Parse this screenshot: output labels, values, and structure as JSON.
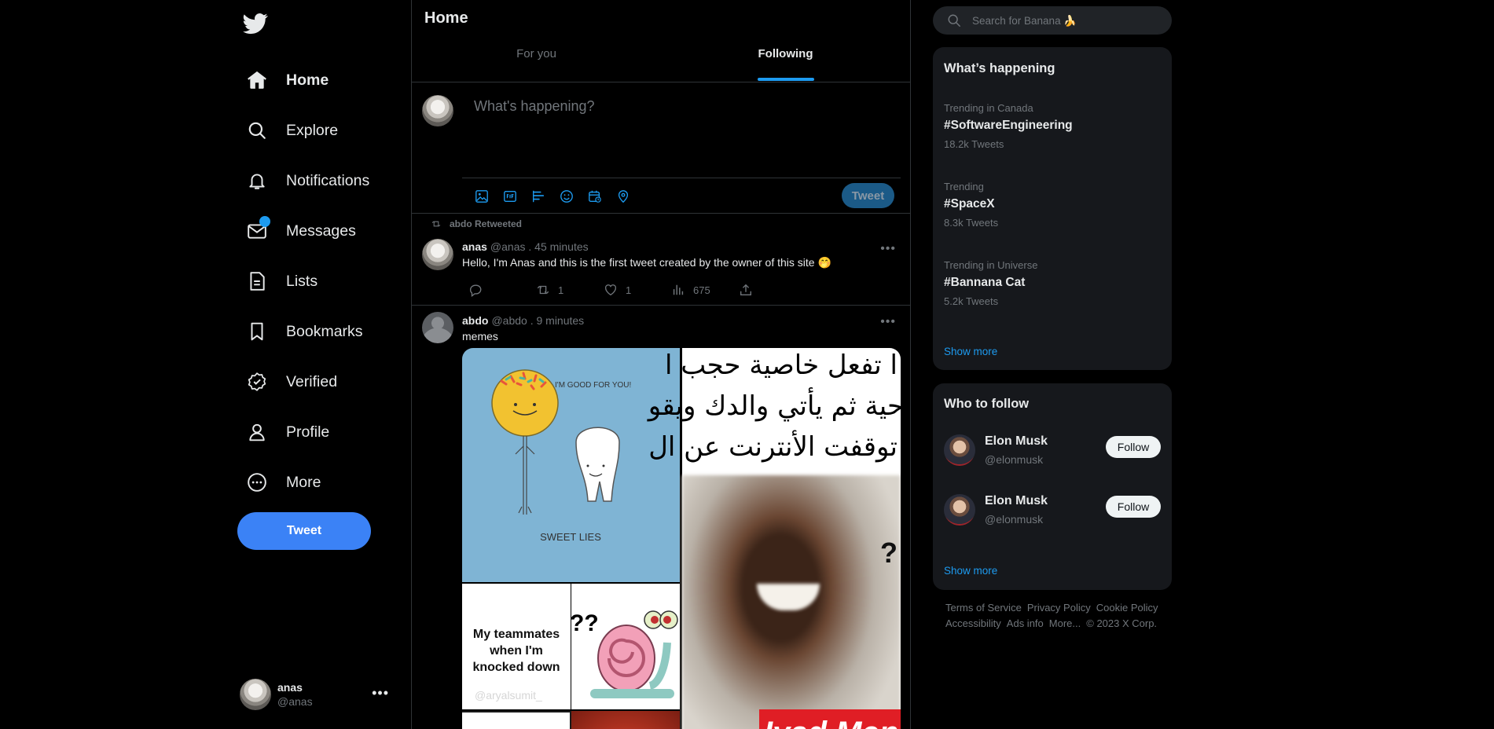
{
  "sidebar": {
    "nav": [
      {
        "label": "Home",
        "icon": "home-icon"
      },
      {
        "label": "Explore",
        "icon": "search-icon"
      },
      {
        "label": "Notifications",
        "icon": "bell-icon"
      },
      {
        "label": "Messages",
        "icon": "envelope-icon"
      },
      {
        "label": "Lists",
        "icon": "list-icon"
      },
      {
        "label": "Bookmarks",
        "icon": "bookmark-icon"
      },
      {
        "label": "Verified",
        "icon": "verified-icon"
      },
      {
        "label": "Profile",
        "icon": "person-icon"
      },
      {
        "label": "More",
        "icon": "more-circle-icon"
      }
    ],
    "tweet_button": "Tweet",
    "account": {
      "name": "anas",
      "handle": "@anas"
    }
  },
  "main": {
    "title": "Home",
    "tabs": [
      {
        "label": "For you"
      },
      {
        "label": "Following"
      }
    ],
    "composer": {
      "placeholder": "What's happening?",
      "tweet_button": "Tweet"
    },
    "tweets": [
      {
        "retweeted_by": "abdo Retweeted",
        "name": "anas",
        "meta": "@anas . 45 minutes",
        "text": "Hello, I'm Anas and this is the first tweet created by the owner of this site 🤭",
        "replies": "",
        "retweets": "1",
        "likes": "1",
        "views": "675"
      },
      {
        "name": "abdo",
        "meta": "@abdo . 9 minutes",
        "text": "memes",
        "media": {
          "m1_caption": "SWEET LIES",
          "m1_bubble": "I'M GOOD FOR YOU!",
          "m2_arabic_1": "ا تفعل خاصية حجب ا",
          "m2_arabic_2": "حية ثم يأتي والدك ويقو",
          "m2_arabic_3": "توقفت الأنترنت عن ال",
          "m2_brand": "Iyad Men",
          "m3_text": "My teammates when I'm knocked down",
          "m3_watermark": "@aryalsumit_",
          "m4_marks": "??"
        }
      }
    ]
  },
  "right": {
    "search_placeholder": "Search for Banana 🍌",
    "happening": {
      "title": "What’s happening",
      "trends": [
        {
          "context": "Trending in Canada",
          "tag": "#SoftwareEngineering",
          "count": "18.2k Tweets"
        },
        {
          "context": "Trending",
          "tag": "#SpaceX",
          "count": "8.3k Tweets"
        },
        {
          "context": "Trending in Universe",
          "tag": "#Bannana Cat",
          "count": "5.2k Tweets"
        }
      ],
      "show_more": "Show more"
    },
    "who_to_follow": {
      "title": "Who to follow",
      "people": [
        {
          "name": "Elon Musk",
          "handle": "@elonmusk",
          "button": "Follow"
        },
        {
          "name": "Elon Musk",
          "handle": "@elonmusk",
          "button": "Follow"
        }
      ],
      "show_more": "Show more"
    },
    "footer": [
      "Terms of Service",
      "Privacy Policy",
      "Cookie Policy",
      "Accessibility",
      "Ads info",
      "More...",
      "© 2023 X Corp."
    ]
  },
  "colors": {
    "accent": "#1d9bf0",
    "tweet_button": "#3b82f6",
    "background": "#000000",
    "panel": "#16181c",
    "muted": "#71767b"
  }
}
